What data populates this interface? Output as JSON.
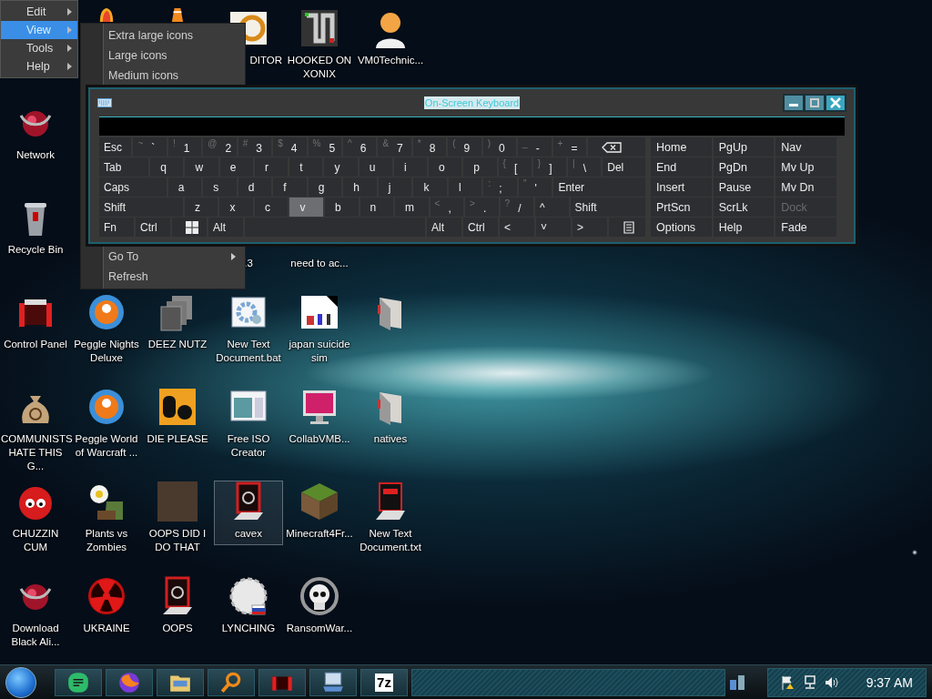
{
  "desktop": {
    "rows": [
      [
        null,
        {
          "kind": "flame",
          "selected": false
        },
        {
          "kind": "cone",
          "selected": false
        },
        {
          "kind": "logo",
          "label": "DITOR",
          "clipped": true,
          "selected": false
        },
        {
          "kind": "maze",
          "label": "HOOKED ON XONIX",
          "selected": false
        },
        {
          "kind": "person",
          "label": "VM0Technic...",
          "selected": false
        }
      ],
      [
        {
          "kind": "orb",
          "label": "Network",
          "selected": false
        }
      ],
      [
        {
          "kind": "bin",
          "label": "Recycle Bin",
          "selected": false
        },
        null,
        null,
        {
          "kind": "covered",
          "label": ".3",
          "selected": false
        },
        {
          "kind": "covered",
          "label": "need to ac...",
          "selected": false
        }
      ],
      [
        {
          "kind": "toolbox",
          "label": "Control Panel",
          "selected": false
        },
        {
          "kind": "ball",
          "label": "Peggle Nights Deluxe",
          "selected": false
        },
        {
          "kind": "windows",
          "label": "DEEZ NUTZ",
          "selected": false
        },
        {
          "kind": "gears",
          "label": "New Text Document.bat",
          "selected": false
        },
        {
          "kind": "image",
          "label": "japan suicide sim",
          "selected": false
        },
        {
          "kind": "folder",
          "selected": false
        }
      ],
      [
        {
          "kind": "bag",
          "label": "COMMUNISTS HATE THIS G...",
          "selected": false
        },
        {
          "kind": "ball",
          "label": "Peggle World of Warcraft ...",
          "selected": false
        },
        {
          "kind": "tile",
          "label": "DIE PLEASE",
          "selected": false
        },
        {
          "kind": "window",
          "label": "Free ISO Creator",
          "selected": false
        },
        {
          "kind": "monitor",
          "label": "CollabVMB...",
          "selected": false
        },
        {
          "kind": "folder",
          "label": "natives",
          "selected": false
        }
      ],
      [
        {
          "kind": "creature",
          "label": "CHUZZIN CUM",
          "selected": false
        },
        {
          "kind": "flower",
          "label": "Plants vs Zombies",
          "selected": false
        },
        {
          "kind": "photo",
          "label": "OOPS DID I DO THAT",
          "selected": false
        },
        {
          "kind": "device",
          "label": "cavex",
          "selected": true
        },
        {
          "kind": "block",
          "label": "Minecraft4Fr...",
          "selected": false
        },
        {
          "kind": "txt",
          "label": "New Text Document.txt",
          "selected": false
        }
      ],
      [
        {
          "kind": "orb",
          "label": "Download Black Ali...",
          "selected": false
        },
        {
          "kind": "hazard",
          "label": "UKRAINE",
          "selected": false
        },
        {
          "kind": "device",
          "label": "OOPS",
          "selected": false
        },
        {
          "kind": "seal",
          "label": "LYNCHING",
          "selected": false
        },
        {
          "kind": "skull",
          "label": "RansomWar...",
          "selected": false
        }
      ]
    ]
  },
  "menu": {
    "items": [
      {
        "label": "Edit",
        "selected": false,
        "has_submenu": true
      },
      {
        "label": "View",
        "selected": true,
        "has_submenu": true
      },
      {
        "label": "Tools",
        "selected": false,
        "has_submenu": true
      },
      {
        "label": "Help",
        "selected": false,
        "has_submenu": true
      }
    ]
  },
  "submenu": {
    "upper_items": [
      {
        "label": "Extra large icons"
      },
      {
        "label": "Large icons"
      },
      {
        "label": "Medium icons"
      }
    ],
    "lower_items": [
      {
        "label": "Go To",
        "has_submenu": true
      },
      {
        "label": "Refresh",
        "has_submenu": false
      }
    ]
  },
  "osk": {
    "title": "On-Screen Keyboard",
    "main_rows": [
      [
        {
          "kind": "mod",
          "label": "Esc",
          "hovered": false
        },
        {
          "kind": "char",
          "shift": "~",
          "label": "`",
          "hovered": false
        },
        {
          "kind": "char",
          "shift": "!",
          "label": "1",
          "hovered": false
        },
        {
          "kind": "char",
          "shift": "@",
          "label": "2",
          "hovered": false
        },
        {
          "kind": "char",
          "shift": "#",
          "label": "3",
          "hovered": false
        },
        {
          "kind": "char",
          "shift": "$",
          "label": "4",
          "hovered": false
        },
        {
          "kind": "char",
          "shift": "%",
          "label": "5",
          "hovered": false
        },
        {
          "kind": "char",
          "shift": "^",
          "label": "6",
          "hovered": false
        },
        {
          "kind": "char",
          "shift": "&",
          "label": "7",
          "hovered": false
        },
        {
          "kind": "char",
          "shift": "*",
          "label": "8",
          "hovered": false
        },
        {
          "kind": "char",
          "shift": "(",
          "label": "9",
          "hovered": false
        },
        {
          "kind": "char",
          "shift": ")",
          "label": "0",
          "hovered": false
        },
        {
          "kind": "char",
          "shift": "_",
          "label": "-",
          "hovered": false
        },
        {
          "kind": "char",
          "shift": "+",
          "label": "=",
          "hovered": false
        },
        {
          "kind": "backspace",
          "hovered": false
        }
      ],
      [
        {
          "kind": "mod",
          "label": "Tab",
          "hovered": false
        },
        {
          "kind": "char",
          "label": "q",
          "hovered": false
        },
        {
          "kind": "char",
          "label": "w",
          "hovered": false
        },
        {
          "kind": "char",
          "label": "e",
          "hovered": false
        },
        {
          "kind": "char",
          "label": "r",
          "hovered": false
        },
        {
          "kind": "char",
          "label": "t",
          "hovered": false
        },
        {
          "kind": "char",
          "label": "y",
          "hovered": false
        },
        {
          "kind": "char",
          "label": "u",
          "hovered": false
        },
        {
          "kind": "char",
          "label": "i",
          "hovered": false
        },
        {
          "kind": "char",
          "label": "o",
          "hovered": false
        },
        {
          "kind": "char",
          "label": "p",
          "hovered": false
        },
        {
          "kind": "char",
          "shift": "{",
          "label": "[",
          "hovered": false
        },
        {
          "kind": "char",
          "shift": "}",
          "label": "]",
          "hovered": false
        },
        {
          "kind": "char",
          "shift": "|",
          "label": "\\",
          "hovered": false
        },
        {
          "kind": "mod",
          "label": "Del",
          "hovered": false
        }
      ],
      [
        {
          "kind": "mod",
          "label": "Caps",
          "hovered": false
        },
        {
          "kind": "char",
          "label": "a",
          "hovered": false
        },
        {
          "kind": "char",
          "label": "s",
          "hovered": false
        },
        {
          "kind": "char",
          "label": "d",
          "hovered": false
        },
        {
          "kind": "char",
          "label": "f",
          "hovered": false
        },
        {
          "kind": "char",
          "label": "g",
          "hovered": false
        },
        {
          "kind": "char",
          "label": "h",
          "hovered": false
        },
        {
          "kind": "char",
          "label": "j",
          "hovered": false
        },
        {
          "kind": "char",
          "label": "k",
          "hovered": false
        },
        {
          "kind": "char",
          "label": "l",
          "hovered": false
        },
        {
          "kind": "char",
          "shift": ":",
          "label": ";",
          "hovered": false
        },
        {
          "kind": "char",
          "shift": "\"",
          "label": "'",
          "hovered": false
        },
        {
          "kind": "mod",
          "label": "Enter",
          "hovered": false
        }
      ],
      [
        {
          "kind": "mod",
          "label": "Shift",
          "hovered": false
        },
        {
          "kind": "char",
          "label": "z",
          "hovered": false
        },
        {
          "kind": "char",
          "label": "x",
          "hovered": false
        },
        {
          "kind": "char",
          "label": "c",
          "hovered": false
        },
        {
          "kind": "char",
          "label": "v",
          "hovered": true
        },
        {
          "kind": "char",
          "label": "b",
          "hovered": false
        },
        {
          "kind": "char",
          "label": "n",
          "hovered": false
        },
        {
          "kind": "char",
          "label": "m",
          "hovered": false
        },
        {
          "kind": "char",
          "shift": "<",
          "label": ",",
          "hovered": false
        },
        {
          "kind": "char",
          "shift": ">",
          "label": ".",
          "hovered": false
        },
        {
          "kind": "char",
          "shift": "?",
          "label": "/",
          "hovered": false
        },
        {
          "kind": "mod",
          "label": "^",
          "hovered": false
        },
        {
          "kind": "mod",
          "label": "Shift",
          "hovered": false
        }
      ],
      [
        {
          "kind": "mod",
          "label": "Fn",
          "hovered": false
        },
        {
          "kind": "mod",
          "label": "Ctrl",
          "hovered": false
        },
        {
          "kind": "windows",
          "hovered": false
        },
        {
          "kind": "mod",
          "label": "Alt",
          "hovered": false
        },
        {
          "kind": "space",
          "hovered": false
        },
        {
          "kind": "mod",
          "label": "Alt",
          "hovered": false
        },
        {
          "kind": "mod",
          "label": "Ctrl",
          "hovered": false
        },
        {
          "kind": "mod",
          "label": "<",
          "hovered": false
        },
        {
          "kind": "mod",
          "label": "˅",
          "hovered": false
        },
        {
          "kind": "mod",
          "label": ">",
          "hovered": false
        },
        {
          "kind": "menu",
          "hovered": false
        }
      ]
    ],
    "nav_rows": [
      [
        {
          "label": "Home",
          "disabled": false
        },
        {
          "label": "PgUp",
          "disabled": false
        },
        {
          "label": "Nav",
          "disabled": false
        }
      ],
      [
        {
          "label": "End",
          "disabled": false
        },
        {
          "label": "PgDn",
          "disabled": false
        },
        {
          "label": "Mv Up",
          "disabled": false
        }
      ],
      [
        {
          "label": "Insert",
          "disabled": false
        },
        {
          "label": "Pause",
          "disabled": false
        },
        {
          "label": "Mv Dn",
          "disabled": false
        }
      ],
      [
        {
          "label": "PrtScn",
          "disabled": false
        },
        {
          "label": "ScrLk",
          "disabled": false
        },
        {
          "label": "Dock",
          "disabled": true
        }
      ],
      [
        {
          "label": "Options",
          "disabled": false
        },
        {
          "label": "Help",
          "disabled": false
        },
        {
          "label": "Fade",
          "disabled": false
        }
      ]
    ]
  },
  "taskbar": {
    "buttons": [
      {
        "kind": "chat"
      },
      {
        "kind": "browser"
      },
      {
        "kind": "folder"
      },
      {
        "kind": "magnifier"
      },
      {
        "kind": "app"
      },
      {
        "kind": "keyboard"
      },
      {
        "kind": "archive",
        "label": "7z"
      }
    ],
    "clock": "9:37 AM"
  }
}
